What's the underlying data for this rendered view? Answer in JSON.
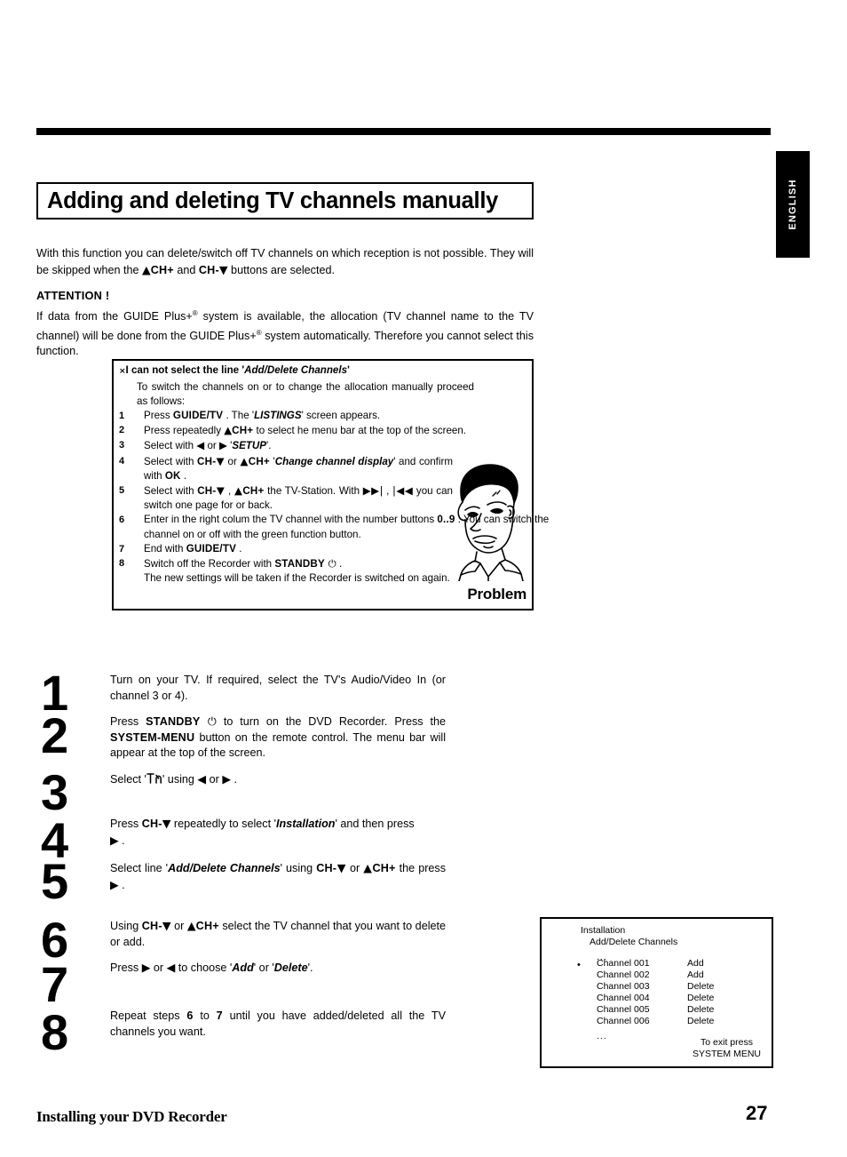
{
  "page": {
    "language_tab": "ENGLISH",
    "title": "Adding and deleting TV channels manually",
    "footer_title": "Installing your DVD Recorder",
    "page_number": "27"
  },
  "intro": {
    "line1_a": "With this function you can delete/switch off TV channels on which reception is not possible. They will be skipped when the ",
    "key_chplus": "CH+",
    "line1_b": " and ",
    "key_chminus": "CH-",
    "line1_c": " buttons are selected."
  },
  "attention": {
    "heading": "ATTENTION !",
    "body_a": "If data from the GUIDE Plus+",
    "body_b": " system is available, the allocation (TV channel name to the TV channel) will be done from the GUIDE Plus+",
    "body_c": " system automatically. Therefore you cannot select this function."
  },
  "problem_box": {
    "marker": "×",
    "title_a": "I can not select the line '",
    "title_screen": "Add/Delete Channels",
    "title_b": "'",
    "lead": "To switch the channels on or to change the allocation manually proceed as follows:",
    "word_problem": "Problem",
    "steps": [
      {
        "num": "1",
        "parts": [
          {
            "t": "Press  ",
            "s": "plain"
          },
          {
            "t": "GUIDE/TV",
            "s": "key"
          },
          {
            "t": " . The '",
            "s": "plain"
          },
          {
            "t": "LISTINGS",
            "s": "screen"
          },
          {
            "t": "' screen appears.",
            "s": "plain"
          }
        ]
      },
      {
        "num": "2",
        "parts": [
          {
            "t": "Press repeatedly  ",
            "s": "plain"
          },
          {
            "t": "▲",
            "s": "glyph"
          },
          {
            "t": "CH+",
            "s": "key"
          },
          {
            "t": " to select he menu bar at the top of the screen.",
            "s": "plain"
          }
        ]
      },
      {
        "num": "3",
        "parts": [
          {
            "t": "Select with  ",
            "s": "plain"
          },
          {
            "t": "◀",
            "s": "glyph"
          },
          {
            "t": " or ",
            "s": "plain"
          },
          {
            "t": "▶",
            "s": "glyph"
          },
          {
            "t": " '",
            "s": "plain"
          },
          {
            "t": "SETUP",
            "s": "screen"
          },
          {
            "t": "'.",
            "s": "plain"
          }
        ]
      },
      {
        "num": "4",
        "parts": [
          {
            "t": "Select with  ",
            "s": "plain"
          },
          {
            "t": "CH-",
            "s": "key"
          },
          {
            "t": "▼",
            "s": "glyph"
          },
          {
            "t": " or  ",
            "s": "plain"
          },
          {
            "t": "▲",
            "s": "glyph"
          },
          {
            "t": "CH+",
            "s": "key"
          },
          {
            "t": " '",
            "s": "plain"
          },
          {
            "t": "Change channel display",
            "s": "screen"
          },
          {
            "t": "' and confirm with  ",
            "s": "plain"
          },
          {
            "t": "OK",
            "s": "key"
          },
          {
            "t": " .",
            "s": "plain"
          }
        ]
      },
      {
        "num": "5",
        "parts": [
          {
            "t": "Select with  ",
            "s": "plain"
          },
          {
            "t": "CH-",
            "s": "key"
          },
          {
            "t": "▼",
            "s": "glyph"
          },
          {
            "t": " ,  ",
            "s": "plain"
          },
          {
            "t": "▲",
            "s": "glyph"
          },
          {
            "t": "CH+",
            "s": "key"
          },
          {
            "t": " the TV-Station. With  ",
            "s": "plain"
          },
          {
            "t": "▶▶|",
            "s": "glyph"
          },
          {
            "t": " , ",
            "s": "plain"
          },
          {
            "t": "|◀◀",
            "s": "glyph"
          },
          {
            "t": " you can switch one page for or back.",
            "s": "plain"
          }
        ]
      },
      {
        "num": "6",
        "parts": [
          {
            "t": "Enter in the right colum the TV channel with the number buttons ",
            "s": "plain"
          },
          {
            "t": "0..9",
            "s": "key"
          },
          {
            "t": " . You can switch the channel on or off with the green function button.",
            "s": "plain"
          }
        ]
      },
      {
        "num": "7",
        "parts": [
          {
            "t": "End with  ",
            "s": "plain"
          },
          {
            "t": "GUIDE/TV",
            "s": "key"
          },
          {
            "t": " .",
            "s": "plain"
          }
        ]
      },
      {
        "num": "8",
        "parts": [
          {
            "t": "Switch off the Recorder with  ",
            "s": "plain"
          },
          {
            "t": "STANDBY",
            "s": "key"
          },
          {
            "t": " ⏻",
            "s": "glyph"
          },
          {
            "t": " .",
            "s": "plain"
          },
          {
            "t": "\n",
            "s": "break"
          },
          {
            "t": "The new settings will be taken if the Recorder is switched on again.",
            "s": "plain"
          }
        ]
      }
    ]
  },
  "main_steps": [
    {
      "num": "1",
      "parts": [
        {
          "t": "Turn on your TV. If required, select the TV's Audio/Video In (or channel 3 or 4).",
          "s": "plain"
        }
      ]
    },
    {
      "num": "2",
      "parts": [
        {
          "t": "Press  ",
          "s": "plain"
        },
        {
          "t": "STANDBY",
          "s": "key"
        },
        {
          "t": " ⏻",
          "s": "glyph"
        },
        {
          "t": " to turn on the DVD Recorder. Press the  ",
          "s": "plain"
        },
        {
          "t": "SYSTEM-MENU",
          "s": "key"
        },
        {
          "t": " button on the remote control. The menu bar will appear at the top of the screen.",
          "s": "plain"
        }
      ]
    },
    {
      "num": "3",
      "parts": [
        {
          "t": "Select '",
          "s": "plain"
        },
        {
          "t": "TV-antenna-icon",
          "s": "icon"
        },
        {
          "t": "' using  ",
          "s": "plain"
        },
        {
          "t": "◀",
          "s": "glyph"
        },
        {
          "t": " or ",
          "s": "plain"
        },
        {
          "t": "▶",
          "s": "glyph"
        },
        {
          "t": " .",
          "s": "plain"
        }
      ]
    },
    {
      "num": "4",
      "parts": [
        {
          "t": "Press  ",
          "s": "plain"
        },
        {
          "t": "CH-",
          "s": "key"
        },
        {
          "t": "▼",
          "s": "glyph"
        },
        {
          "t": " repeatedly to select '",
          "s": "plain"
        },
        {
          "t": "Installation",
          "s": "screen"
        },
        {
          "t": "' and then press ",
          "s": "plain"
        },
        {
          "t": "\n",
          "s": "break"
        },
        {
          "t": "▶",
          "s": "glyph"
        },
        {
          "t": " .",
          "s": "plain"
        }
      ]
    },
    {
      "num": "5",
      "parts": [
        {
          "t": "Select line '",
          "s": "plain"
        },
        {
          "t": "Add/Delete Channels",
          "s": "screen"
        },
        {
          "t": "' using  ",
          "s": "plain"
        },
        {
          "t": "CH-",
          "s": "key"
        },
        {
          "t": "▼",
          "s": "glyph"
        },
        {
          "t": " or  ",
          "s": "plain"
        },
        {
          "t": "▲",
          "s": "glyph"
        },
        {
          "t": "CH+",
          "s": "key"
        },
        {
          "t": " the press ",
          "s": "plain"
        },
        {
          "t": "▶",
          "s": "glyph"
        },
        {
          "t": " .",
          "s": "plain"
        }
      ]
    },
    {
      "num": "6",
      "parts": [
        {
          "t": "Using  ",
          "s": "plain"
        },
        {
          "t": "CH-",
          "s": "key"
        },
        {
          "t": "▼",
          "s": "glyph"
        },
        {
          "t": " or  ",
          "s": "plain"
        },
        {
          "t": "▲",
          "s": "glyph"
        },
        {
          "t": "CH+",
          "s": "key"
        },
        {
          "t": " select the TV channel that you want to delete or add.",
          "s": "plain"
        }
      ]
    },
    {
      "num": "7",
      "parts": [
        {
          "t": "Press ",
          "s": "plain"
        },
        {
          "t": "▶",
          "s": "glyph"
        },
        {
          "t": " or ",
          "s": "plain"
        },
        {
          "t": "◀",
          "s": "glyph"
        },
        {
          "t": " to choose '",
          "s": "plain"
        },
        {
          "t": "Add",
          "s": "screen"
        },
        {
          "t": "' or '",
          "s": "plain"
        },
        {
          "t": "Delete",
          "s": "screen"
        },
        {
          "t": "'.",
          "s": "plain"
        }
      ]
    },
    {
      "num": "8",
      "parts": [
        {
          "t": "Repeat steps  ",
          "s": "plain"
        },
        {
          "t": "6",
          "s": "key"
        },
        {
          "t": " to ",
          "s": "plain"
        },
        {
          "t": "7",
          "s": "key"
        },
        {
          "t": " until you have added/deleted all the TV channels you want.",
          "s": "plain"
        }
      ]
    }
  ],
  "tv_screen": {
    "title_line1": "Installation",
    "title_line2": "Add/Delete Channels",
    "dots_top": "...",
    "dots_bottom": "...",
    "bullet": "•",
    "rows": [
      {
        "channel": "Channel 001",
        "action": "Add"
      },
      {
        "channel": "Channel 002",
        "action": "Add"
      },
      {
        "channel": "Channel 003",
        "action": "Delete"
      },
      {
        "channel": "Channel 004",
        "action": "Delete"
      },
      {
        "channel": "Channel 005",
        "action": "Delete"
      },
      {
        "channel": "Channel 006",
        "action": "Delete"
      }
    ],
    "exit_line1": "To exit press",
    "exit_line2": "SYSTEM MENU"
  }
}
